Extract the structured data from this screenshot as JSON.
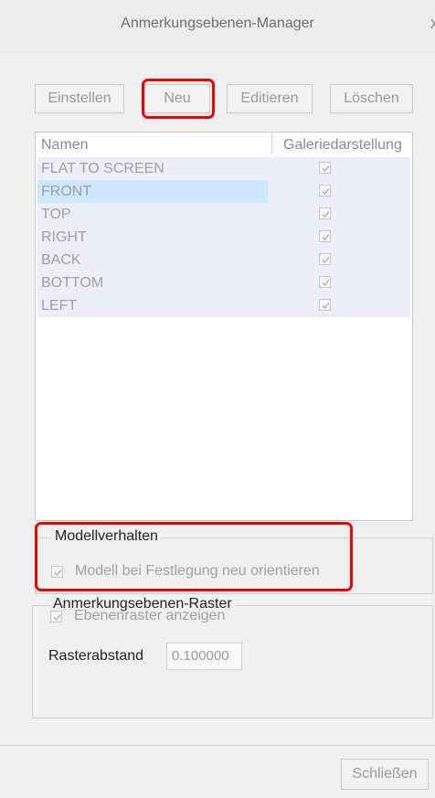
{
  "window": {
    "title": "Anmerkungsebenen-Manager",
    "close_glyph": "x"
  },
  "toolbar": {
    "set_label": "Einstellen",
    "new_label": "Neu",
    "edit_label": "Editieren",
    "delete_label": "Löschen"
  },
  "list": {
    "headers": {
      "name": "Namen",
      "gallery": "Galeriedarstellung"
    },
    "rows": [
      {
        "name": "FLAT TO SCREEN",
        "gallery_checked": true,
        "selected": false
      },
      {
        "name": "FRONT",
        "gallery_checked": true,
        "selected": true
      },
      {
        "name": "TOP",
        "gallery_checked": true,
        "selected": false
      },
      {
        "name": "RIGHT",
        "gallery_checked": true,
        "selected": false
      },
      {
        "name": "BACK",
        "gallery_checked": true,
        "selected": false
      },
      {
        "name": "BOTTOM",
        "gallery_checked": true,
        "selected": false
      },
      {
        "name": "LEFT",
        "gallery_checked": true,
        "selected": false
      }
    ]
  },
  "model_behavior": {
    "title": "Modellverhalten",
    "reorient_label": "Modell bei Festlegung neu orientieren",
    "reorient_checked": true
  },
  "grid": {
    "title": "Anmerkungsebenen-Raster",
    "show_label": "Ebenenraster anzeigen",
    "show_checked": true,
    "spacing_label": "Rasterabstand",
    "spacing_value": "0.100000"
  },
  "footer": {
    "close_label": "Schließen"
  },
  "colors": {
    "highlight": "#ee0000",
    "selection": "#cce8ff",
    "row_background": "#eeeefb"
  }
}
